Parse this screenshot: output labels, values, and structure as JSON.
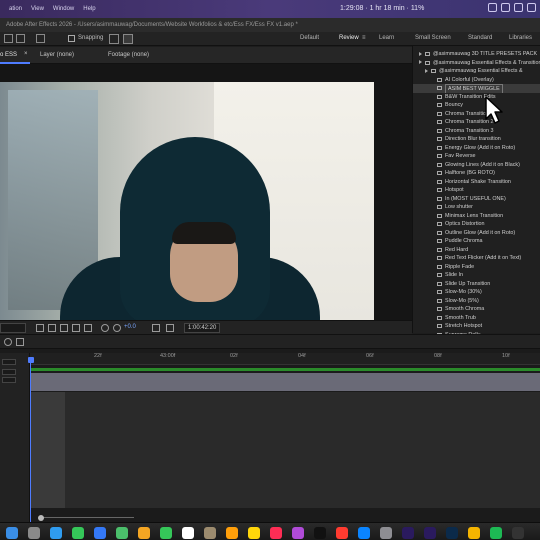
{
  "menubar": {
    "items": [
      "ation",
      "View",
      "Window",
      "Help"
    ],
    "clock": "1:29:08 · 1 hr 18 min · 11%"
  },
  "pathbar": {
    "text": "Adobe After Effects 2026 - /Users/asimmauwag/Documents/Website Workfolios & etc/Ess FX/Ess FX v1.aep *"
  },
  "toolbar": {
    "left_label": "o ESS",
    "snapping_label": "Snapping"
  },
  "workspaces": {
    "items": [
      {
        "label": "Default"
      },
      {
        "label": "Review"
      },
      {
        "label": "Learn"
      },
      {
        "label": "Small Screen"
      },
      {
        "label": "Standard"
      },
      {
        "label": "Libraries"
      }
    ]
  },
  "panel_tabs": {
    "comp": "o ESS",
    "layer": "Layer (none)",
    "footage": "Footage (none)"
  },
  "viewer": {
    "exposure": "+0.0",
    "timecode": "1:00:42:20"
  },
  "presets": {
    "rows": [
      {
        "label": "@asimmauwag 3D TITLE PRESETS PACK",
        "indent": 1,
        "kind": "folder"
      },
      {
        "label": "@asimmauwag Essential Effects & Transitions",
        "indent": 1,
        "kind": "folder"
      },
      {
        "label": "@asimmauwag Essential Effects &",
        "indent": 2,
        "kind": "folder"
      },
      {
        "label": "AI Colorful (Overlay)",
        "indent": 3,
        "kind": "file"
      },
      {
        "label": "ASIM BEST WIGGLE",
        "indent": 3,
        "kind": "file",
        "selected": true
      },
      {
        "label": "B&W Transition Edits",
        "indent": 3,
        "kind": "file"
      },
      {
        "label": "Bouncy",
        "indent": 3,
        "kind": "file"
      },
      {
        "label": "Chroma Transition",
        "indent": 3,
        "kind": "file"
      },
      {
        "label": "Chroma Transition 2",
        "indent": 3,
        "kind": "file"
      },
      {
        "label": "Chroma Transition 3",
        "indent": 3,
        "kind": "file"
      },
      {
        "label": "Direction Blur transition",
        "indent": 3,
        "kind": "file"
      },
      {
        "label": "Energy Glow (Add it on Roto)",
        "indent": 3,
        "kind": "file"
      },
      {
        "label": "Fav Reverse",
        "indent": 3,
        "kind": "file"
      },
      {
        "label": "Glowing Lines (Add it on Black)",
        "indent": 3,
        "kind": "file"
      },
      {
        "label": "Halftone (BG ROTO)",
        "indent": 3,
        "kind": "file"
      },
      {
        "label": "Horizontal Shake Transition",
        "indent": 3,
        "kind": "file"
      },
      {
        "label": "Hotspot",
        "indent": 3,
        "kind": "file"
      },
      {
        "label": "In (MOST USEFUL ONE)",
        "indent": 3,
        "kind": "file"
      },
      {
        "label": "Low shutter",
        "indent": 3,
        "kind": "file"
      },
      {
        "label": "Minimax Lens Transition",
        "indent": 3,
        "kind": "file"
      },
      {
        "label": "Optics Distortion",
        "indent": 3,
        "kind": "file"
      },
      {
        "label": "Outline Glow (Add it on Roto)",
        "indent": 3,
        "kind": "file"
      },
      {
        "label": "Puddle Chroma",
        "indent": 3,
        "kind": "file"
      },
      {
        "label": "Red Hard",
        "indent": 3,
        "kind": "file"
      },
      {
        "label": "Red Text Flicker (Add it on Text)",
        "indent": 3,
        "kind": "file"
      },
      {
        "label": "Ripple Fade",
        "indent": 3,
        "kind": "file"
      },
      {
        "label": "Slide In",
        "indent": 3,
        "kind": "file"
      },
      {
        "label": "Slide Up Transition",
        "indent": 3,
        "kind": "file"
      },
      {
        "label": "Slow-Mo (30%)",
        "indent": 3,
        "kind": "file"
      },
      {
        "label": "Slow-Mo (5%)",
        "indent": 3,
        "kind": "file"
      },
      {
        "label": "Smooth Chroma",
        "indent": 3,
        "kind": "file"
      },
      {
        "label": "Smooth Trub",
        "indent": 3,
        "kind": "file"
      },
      {
        "label": "Stretch Hotspot",
        "indent": 3,
        "kind": "file"
      },
      {
        "label": "Supreme Dolly",
        "indent": 3,
        "kind": "file"
      }
    ]
  },
  "timeline": {
    "ticks": [
      "22f",
      "43:00f",
      "02f",
      "04f",
      "06f",
      "08f",
      "10f"
    ]
  },
  "colors": {
    "accent": "#4f7cff",
    "menubar": "#4a3a7a",
    "green_bar": "#2a8b2a"
  },
  "dock": {
    "apps": [
      "finder-icon",
      "launchpad-icon",
      "safari-icon",
      "messages-icon",
      "mail-icon",
      "maps-icon",
      "photos-icon",
      "facetime-icon",
      "calendar-icon",
      "contacts-icon",
      "reminders-icon",
      "notes-icon",
      "music-icon",
      "podcasts-icon",
      "tv-icon",
      "news-icon",
      "appstore-icon",
      "settings-icon",
      "aftereffects-icon",
      "premiere-icon",
      "photoshop-icon",
      "chrome-icon",
      "spotify-icon",
      "terminal-icon"
    ]
  }
}
